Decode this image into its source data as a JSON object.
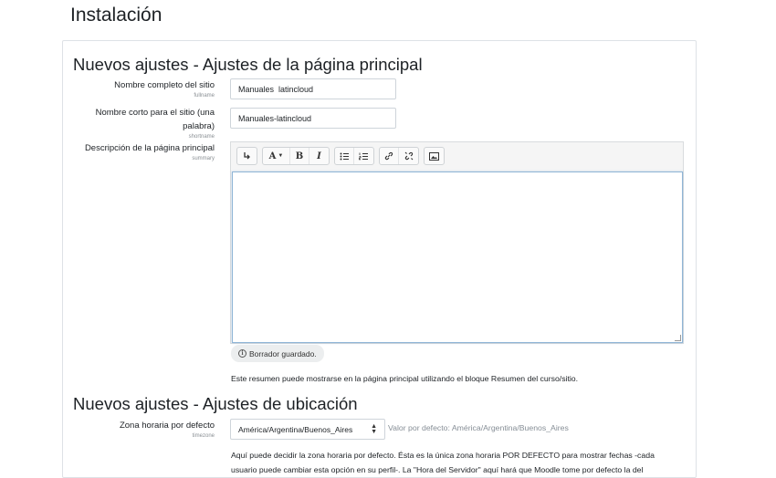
{
  "page": {
    "title": "Instalación"
  },
  "section1": {
    "title": "Nuevos ajustes - Ajustes de la página principal",
    "fullname": {
      "label": "Nombre completo del sitio",
      "sub": "fullname",
      "value": "Manuales  latincloud"
    },
    "shortname": {
      "label_line1": "Nombre corto para el sitio (una",
      "label_line2": "palabra)",
      "sub": "shortname",
      "value": "Manuales-latincloud"
    },
    "summary": {
      "label": "Descripción de la página principal",
      "sub": "summary",
      "toolbar": {
        "format_icon": "paragraph-format-icon",
        "font_label": "A",
        "bold_label": "B",
        "italic_label": "I",
        "unordered_list_icon": "unordered-list-icon",
        "ordered_list_icon": "ordered-list-icon",
        "link_icon": "link-icon",
        "unlink_icon": "unlink-icon",
        "image_icon": "image-icon"
      },
      "draft_status": "Borrador guardado.",
      "help": "Este resumen puede mostrarse en la página principal utilizando el bloque Resumen del curso/sitio."
    }
  },
  "section2": {
    "title": "Nuevos ajustes - Ajustes de ubicación",
    "timezone": {
      "label": "Zona horaria por defecto",
      "sub": "timezone",
      "selected": "América/Argentina/Buenos_Aires",
      "default_text": "Valor por defecto: América/Argentina/Buenos_Aires"
    },
    "description_line1": "Aquí puede decidir la zona horaria por defecto. Ésta es la única zona horaria POR DEFECTO para mostrar fechas -cada",
    "description_line2": "usuario puede cambiar esta opción en su perfil-. La \"Hora del Servidor\" aquí hará que Moodle tome por defecto la del"
  }
}
